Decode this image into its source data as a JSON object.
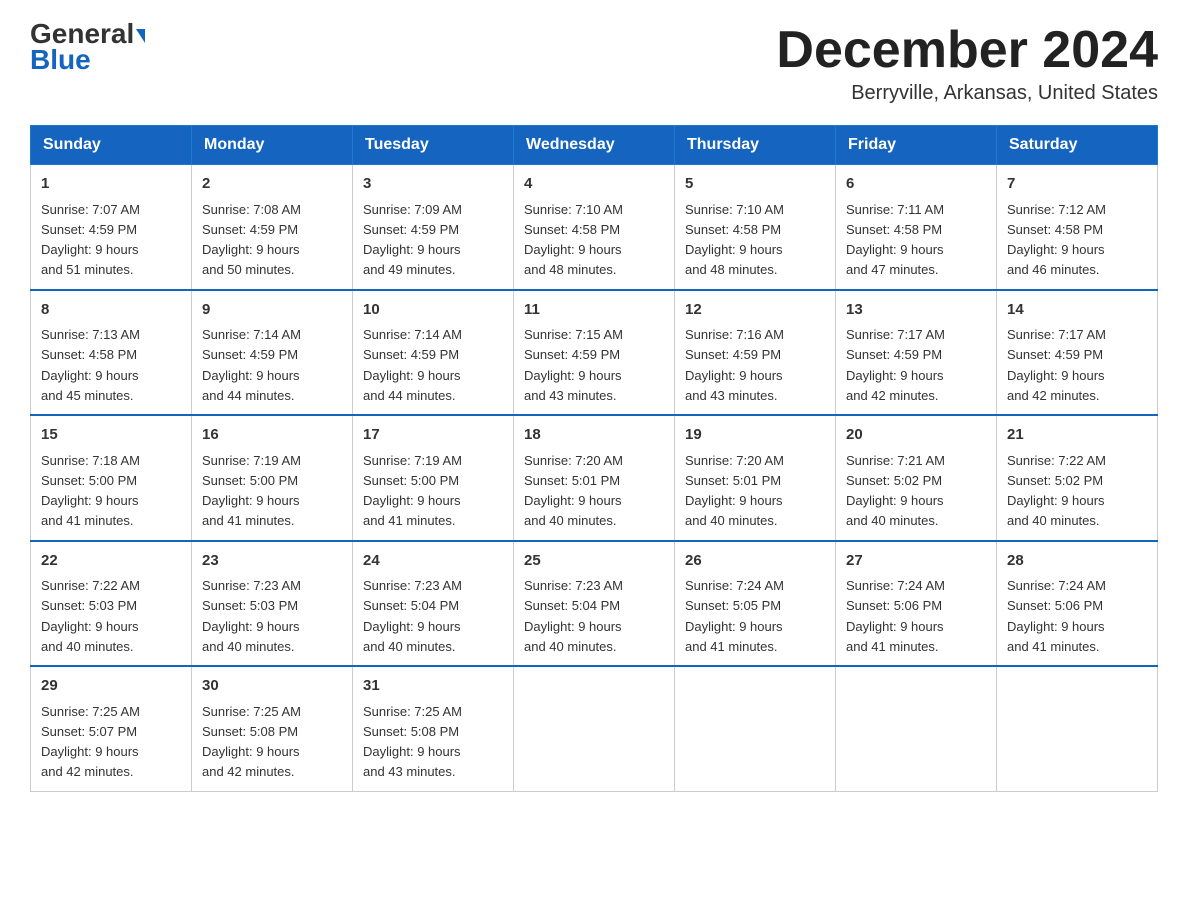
{
  "logo": {
    "text1": "General",
    "text2": "Blue"
  },
  "title": "December 2024",
  "location": "Berryville, Arkansas, United States",
  "days_of_week": [
    "Sunday",
    "Monday",
    "Tuesday",
    "Wednesday",
    "Thursday",
    "Friday",
    "Saturday"
  ],
  "weeks": [
    [
      {
        "day": "1",
        "sunrise": "7:07 AM",
        "sunset": "4:59 PM",
        "daylight": "9 hours and 51 minutes."
      },
      {
        "day": "2",
        "sunrise": "7:08 AM",
        "sunset": "4:59 PM",
        "daylight": "9 hours and 50 minutes."
      },
      {
        "day": "3",
        "sunrise": "7:09 AM",
        "sunset": "4:59 PM",
        "daylight": "9 hours and 49 minutes."
      },
      {
        "day": "4",
        "sunrise": "7:10 AM",
        "sunset": "4:58 PM",
        "daylight": "9 hours and 48 minutes."
      },
      {
        "day": "5",
        "sunrise": "7:10 AM",
        "sunset": "4:58 PM",
        "daylight": "9 hours and 48 minutes."
      },
      {
        "day": "6",
        "sunrise": "7:11 AM",
        "sunset": "4:58 PM",
        "daylight": "9 hours and 47 minutes."
      },
      {
        "day": "7",
        "sunrise": "7:12 AM",
        "sunset": "4:58 PM",
        "daylight": "9 hours and 46 minutes."
      }
    ],
    [
      {
        "day": "8",
        "sunrise": "7:13 AM",
        "sunset": "4:58 PM",
        "daylight": "9 hours and 45 minutes."
      },
      {
        "day": "9",
        "sunrise": "7:14 AM",
        "sunset": "4:59 PM",
        "daylight": "9 hours and 44 minutes."
      },
      {
        "day": "10",
        "sunrise": "7:14 AM",
        "sunset": "4:59 PM",
        "daylight": "9 hours and 44 minutes."
      },
      {
        "day": "11",
        "sunrise": "7:15 AM",
        "sunset": "4:59 PM",
        "daylight": "9 hours and 43 minutes."
      },
      {
        "day": "12",
        "sunrise": "7:16 AM",
        "sunset": "4:59 PM",
        "daylight": "9 hours and 43 minutes."
      },
      {
        "day": "13",
        "sunrise": "7:17 AM",
        "sunset": "4:59 PM",
        "daylight": "9 hours and 42 minutes."
      },
      {
        "day": "14",
        "sunrise": "7:17 AM",
        "sunset": "4:59 PM",
        "daylight": "9 hours and 42 minutes."
      }
    ],
    [
      {
        "day": "15",
        "sunrise": "7:18 AM",
        "sunset": "5:00 PM",
        "daylight": "9 hours and 41 minutes."
      },
      {
        "day": "16",
        "sunrise": "7:19 AM",
        "sunset": "5:00 PM",
        "daylight": "9 hours and 41 minutes."
      },
      {
        "day": "17",
        "sunrise": "7:19 AM",
        "sunset": "5:00 PM",
        "daylight": "9 hours and 41 minutes."
      },
      {
        "day": "18",
        "sunrise": "7:20 AM",
        "sunset": "5:01 PM",
        "daylight": "9 hours and 40 minutes."
      },
      {
        "day": "19",
        "sunrise": "7:20 AM",
        "sunset": "5:01 PM",
        "daylight": "9 hours and 40 minutes."
      },
      {
        "day": "20",
        "sunrise": "7:21 AM",
        "sunset": "5:02 PM",
        "daylight": "9 hours and 40 minutes."
      },
      {
        "day": "21",
        "sunrise": "7:22 AM",
        "sunset": "5:02 PM",
        "daylight": "9 hours and 40 minutes."
      }
    ],
    [
      {
        "day": "22",
        "sunrise": "7:22 AM",
        "sunset": "5:03 PM",
        "daylight": "9 hours and 40 minutes."
      },
      {
        "day": "23",
        "sunrise": "7:23 AM",
        "sunset": "5:03 PM",
        "daylight": "9 hours and 40 minutes."
      },
      {
        "day": "24",
        "sunrise": "7:23 AM",
        "sunset": "5:04 PM",
        "daylight": "9 hours and 40 minutes."
      },
      {
        "day": "25",
        "sunrise": "7:23 AM",
        "sunset": "5:04 PM",
        "daylight": "9 hours and 40 minutes."
      },
      {
        "day": "26",
        "sunrise": "7:24 AM",
        "sunset": "5:05 PM",
        "daylight": "9 hours and 41 minutes."
      },
      {
        "day": "27",
        "sunrise": "7:24 AM",
        "sunset": "5:06 PM",
        "daylight": "9 hours and 41 minutes."
      },
      {
        "day": "28",
        "sunrise": "7:24 AM",
        "sunset": "5:06 PM",
        "daylight": "9 hours and 41 minutes."
      }
    ],
    [
      {
        "day": "29",
        "sunrise": "7:25 AM",
        "sunset": "5:07 PM",
        "daylight": "9 hours and 42 minutes."
      },
      {
        "day": "30",
        "sunrise": "7:25 AM",
        "sunset": "5:08 PM",
        "daylight": "9 hours and 42 minutes."
      },
      {
        "day": "31",
        "sunrise": "7:25 AM",
        "sunset": "5:08 PM",
        "daylight": "9 hours and 43 minutes."
      },
      null,
      null,
      null,
      null
    ]
  ],
  "labels": {
    "sunrise": "Sunrise:",
    "sunset": "Sunset:",
    "daylight": "Daylight:"
  }
}
